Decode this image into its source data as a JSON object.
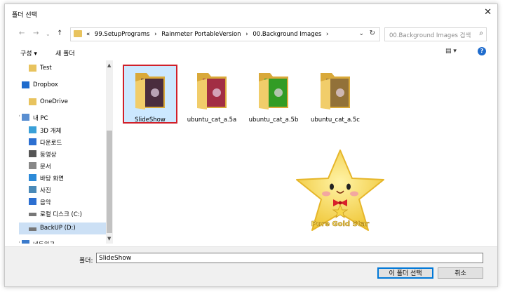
{
  "window": {
    "title": "폴더 선택",
    "close": "✕"
  },
  "nav": {
    "back": "←",
    "forward": "→",
    "up": "↑",
    "history": "⌄"
  },
  "address": {
    "prefix": "«",
    "segments": [
      "99.SetupPrograms",
      "Rainmeter PortableVersion",
      "00.Background Images"
    ],
    "separator": "›",
    "dropdown": "⌄",
    "refresh": "↻"
  },
  "search": {
    "placeholder": "00.Background Images 검색",
    "icon": "⌕"
  },
  "toolbar": {
    "organize": "구성 ▾",
    "new_folder": "새 폴더",
    "view": "▤ ▾",
    "help": "?"
  },
  "sidebar": {
    "items": [
      {
        "label": "Test",
        "icon": "folder-icon"
      },
      {
        "label": "Dropbox",
        "icon": "dropbox-icon"
      },
      {
        "label": "OneDrive",
        "icon": "onedrive-folder-icon"
      },
      {
        "label": "내 PC",
        "icon": "pc-icon"
      },
      {
        "label": "3D 개체",
        "icon": "cube-icon"
      },
      {
        "label": "다운로드",
        "icon": "download-icon"
      },
      {
        "label": "동영상",
        "icon": "video-icon"
      },
      {
        "label": "문서",
        "icon": "document-icon"
      },
      {
        "label": "바탕 화면",
        "icon": "desktop-icon"
      },
      {
        "label": "사진",
        "icon": "pictures-icon"
      },
      {
        "label": "음악",
        "icon": "music-icon"
      },
      {
        "label": "로컬 디스크 (C:)",
        "icon": "drive-icon"
      },
      {
        "label": "BackUP (D:)",
        "icon": "drive-icon"
      },
      {
        "label": "네트워크",
        "icon": "network-icon"
      }
    ],
    "selected_index": 12
  },
  "files": [
    {
      "name": "SlideShow",
      "color": "#3a1f3f",
      "selected": true
    },
    {
      "name": "ubuntu_cat_a.5a",
      "color": "#9b2046"
    },
    {
      "name": "ubuntu_cat_a.5b",
      "color": "#1f9a23"
    },
    {
      "name": "ubuntu_cat_a.5c",
      "color": "#8a6a3a"
    }
  ],
  "logo": {
    "text": "Pure Gold Star"
  },
  "folder_field": {
    "label": "폴더:",
    "value": "SlideShow"
  },
  "buttons": {
    "select": "이 폴더 선택",
    "cancel": "취소"
  },
  "colors": {
    "accent": "#0078d7",
    "selection_border": "#d0202a",
    "selection_fill": "#cce8ff"
  }
}
